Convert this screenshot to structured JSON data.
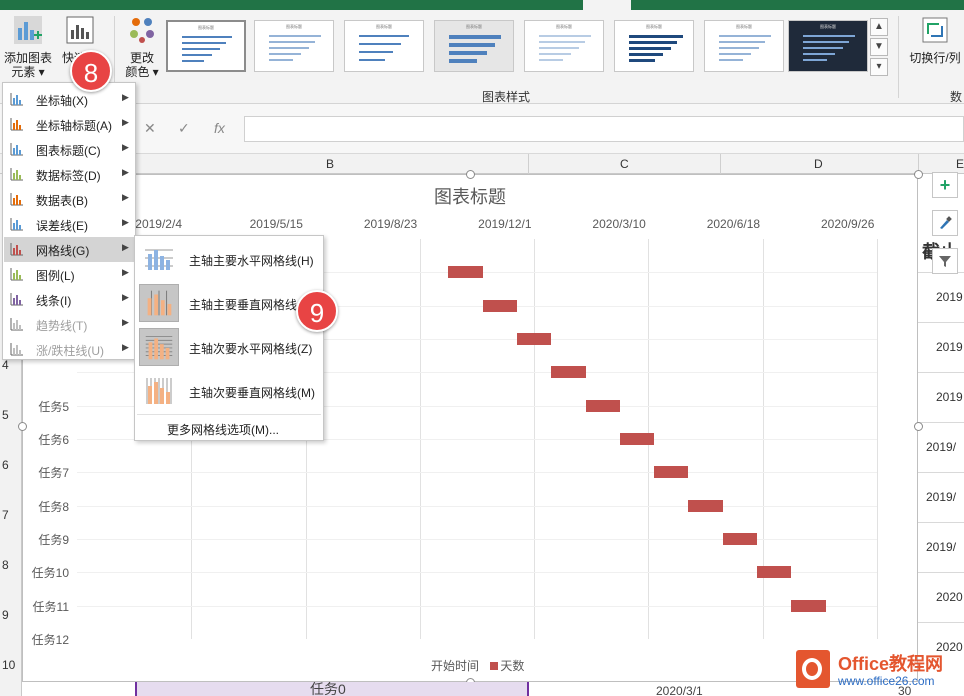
{
  "ribbon": {
    "add_element_label_line1": "添加图表",
    "add_element_label_line2": "元素",
    "quick_layout_label": "快速布",
    "change_color_line1": "更改",
    "change_color_line2": "颜色",
    "chart_styles_group": "图表样式",
    "switch_row_col_label": "切换行/列",
    "data_group_partial": "数",
    "style_thumbnail_title": "图表标题"
  },
  "formula_bar": {
    "cancel_glyph": "✕",
    "enter_glyph": "✓",
    "fx_label": "fx",
    "value": ""
  },
  "columns": [
    "B",
    "C",
    "D",
    "E"
  ],
  "rows": [
    "4",
    "5",
    "6",
    "7",
    "8",
    "9",
    "10"
  ],
  "right_column_cells": [
    "截止",
    "2019",
    "2019",
    "2019",
    "2019/",
    "2019/",
    "2019/",
    "2020",
    "2020"
  ],
  "chart": {
    "title": "图表标题",
    "legend": [
      "开始时间",
      "天数"
    ],
    "bar_color": "#c0504d"
  },
  "chart_data": {
    "type": "bar",
    "orientation": "horizontal-stacked-gantt",
    "title": "图表标题",
    "x_ticks": [
      "2019/2/4",
      "2019/5/15",
      "2019/8/23",
      "2019/12/1",
      "2020/3/10",
      "2020/6/18",
      "2020/9/26"
    ],
    "categories": [
      "任务5",
      "任务6",
      "任务7",
      "任务8",
      "任务9",
      "任务10",
      "任务11",
      "任务12"
    ],
    "hidden_categories_count": 4,
    "series": [
      {
        "name": "开始时间",
        "visible": false
      },
      {
        "name": "天数",
        "color": "#c0504d",
        "rows": [
          {
            "start": "2019-09-17",
            "days": 30
          },
          {
            "start": "2019-10-17",
            "days": 30
          },
          {
            "start": "2019-11-16",
            "days": 30
          },
          {
            "start": "2019-12-16",
            "days": 30
          },
          {
            "start": "2020-01-15",
            "days": 30
          },
          {
            "start": "2020-02-14",
            "days": 30
          },
          {
            "start": "2020-03-15",
            "days": 30
          },
          {
            "start": "2020-04-14",
            "days": 30
          },
          {
            "start": "2020-05-14",
            "days": 30
          },
          {
            "start": "2020-06-13",
            "days": 30
          },
          {
            "start": "2020-07-13",
            "days": 30
          }
        ]
      }
    ],
    "xlim": [
      "2018-10-27",
      "2020-09-26"
    ],
    "grid": {
      "vertical_major": true,
      "horizontal": true
    },
    "legend_position": "bottom"
  },
  "menu": {
    "items": [
      {
        "label": "坐标轴(X)",
        "icon": "axes-icon",
        "enabled": true
      },
      {
        "label": "坐标轴标题(A)",
        "icon": "axis-titles-icon",
        "enabled": true
      },
      {
        "label": "图表标题(C)",
        "icon": "chart-title-icon",
        "enabled": true
      },
      {
        "label": "数据标签(D)",
        "icon": "data-labels-icon",
        "enabled": true
      },
      {
        "label": "数据表(B)",
        "icon": "data-table-icon",
        "enabled": true
      },
      {
        "label": "误差线(E)",
        "icon": "error-bars-icon",
        "enabled": true
      },
      {
        "label": "网格线(G)",
        "icon": "gridlines-icon",
        "enabled": true,
        "active": true
      },
      {
        "label": "图例(L)",
        "icon": "legend-icon",
        "enabled": true
      },
      {
        "label": "线条(I)",
        "icon": "lines-icon",
        "enabled": true
      },
      {
        "label": "趋势线(T)",
        "icon": "trendline-icon",
        "enabled": false
      },
      {
        "label": "涨/跌柱线(U)",
        "icon": "up-down-bars-icon",
        "enabled": false
      }
    ]
  },
  "submenu": {
    "items": [
      {
        "label": "主轴主要水平网格线(H)",
        "highlighted": false
      },
      {
        "label": "主轴主要垂直网格线(V)",
        "highlighted": true
      },
      {
        "label": "主轴次要水平网格线(Z)",
        "highlighted": true
      },
      {
        "label": "主轴次要垂直网格线(M)",
        "highlighted": false
      }
    ],
    "more_options": "更多网格线选项(M)..."
  },
  "badges": [
    "8",
    "9"
  ],
  "bottom_row": {
    "task": "任务0",
    "date": "2020/3/1",
    "tail": "30"
  },
  "watermark": {
    "line1": "Office教程网",
    "line2": "www.office26.com"
  }
}
